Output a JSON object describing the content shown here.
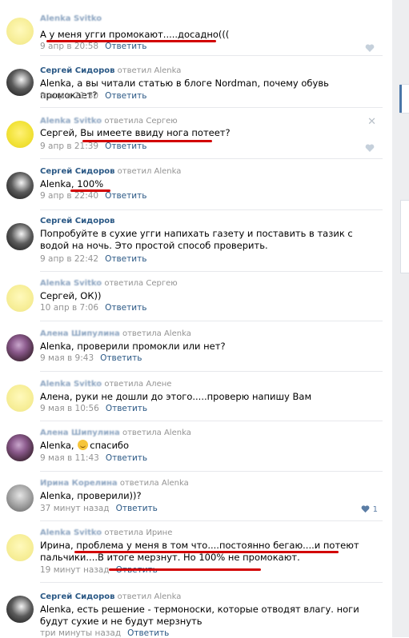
{
  "reply_label": "Ответить",
  "comments": [
    {
      "author": "Alenka Svitko",
      "reply_to": "",
      "text": "А у меня угги промокают.....досадно(((",
      "time": "9 апр в 20:58"
    },
    {
      "author": "Сергей Сидоров",
      "reply_to": "ответил Alenka",
      "text": "Alenka, а вы читали статью в блоге Nordman, почему обувь промокает?",
      "time": "9 апр в 21:30"
    },
    {
      "author": "Alenka Svitko",
      "reply_to": "ответила Сергею",
      "text": "Сергей, Вы имеете ввиду нога потеет?",
      "time": "9 апр в 21:39"
    },
    {
      "author": "Сергей Сидоров",
      "reply_to": "ответил Alenka",
      "text": "Alenka, 100%",
      "time": "9 апр в 22:40"
    },
    {
      "author": "Сергей Сидоров",
      "reply_to": "",
      "text": "Попробуйте в сухие угги напихать газету и поставить в тазик с водой на ночь. Это простой способ проверить.",
      "time": "9 апр в 22:42"
    },
    {
      "author": "Alenka Svitko",
      "reply_to": "ответила Сергею",
      "text": "Сергей, ОК))",
      "time": "10 апр в 7:06"
    },
    {
      "author": "Алена Шипулина",
      "reply_to": "ответила Alenka",
      "text": "Alenka, проверили промокли или нет?",
      "time": "9 мая в 9:43"
    },
    {
      "author": "Alenka Svitko",
      "reply_to": "ответила Алене",
      "text": "Алена, руки не дошли до этого.....проверю напишу Вам",
      "time": "9 мая в 10:56"
    },
    {
      "author": "Алена Шипулина",
      "reply_to": "ответила Alenka",
      "text_before": "Alenka,",
      "text_after": "спасибо",
      "time": "9 мая в 11:43"
    },
    {
      "author": "Ирина Корелина",
      "reply_to": "ответила Alenka",
      "text": "Alenka, проверили))?",
      "time": "37 минут назад",
      "likes": "1"
    },
    {
      "author": "Alenka Svitko",
      "reply_to": "ответила Ирине",
      "text": "Ирина, проблема у меня в том что....постоянно бегаю....и потеют пальчики....В итоге мерзнут. Но 100% не промокают.",
      "time": "19 минут назад"
    },
    {
      "author": "Сергей Сидоров",
      "reply_to": "ответил Alenka",
      "text": "Alenka, есть решение - термоноски, которые отводят влагу. ноги будут сухие и не будут мерзнуть",
      "time": "три минуты назад"
    }
  ]
}
